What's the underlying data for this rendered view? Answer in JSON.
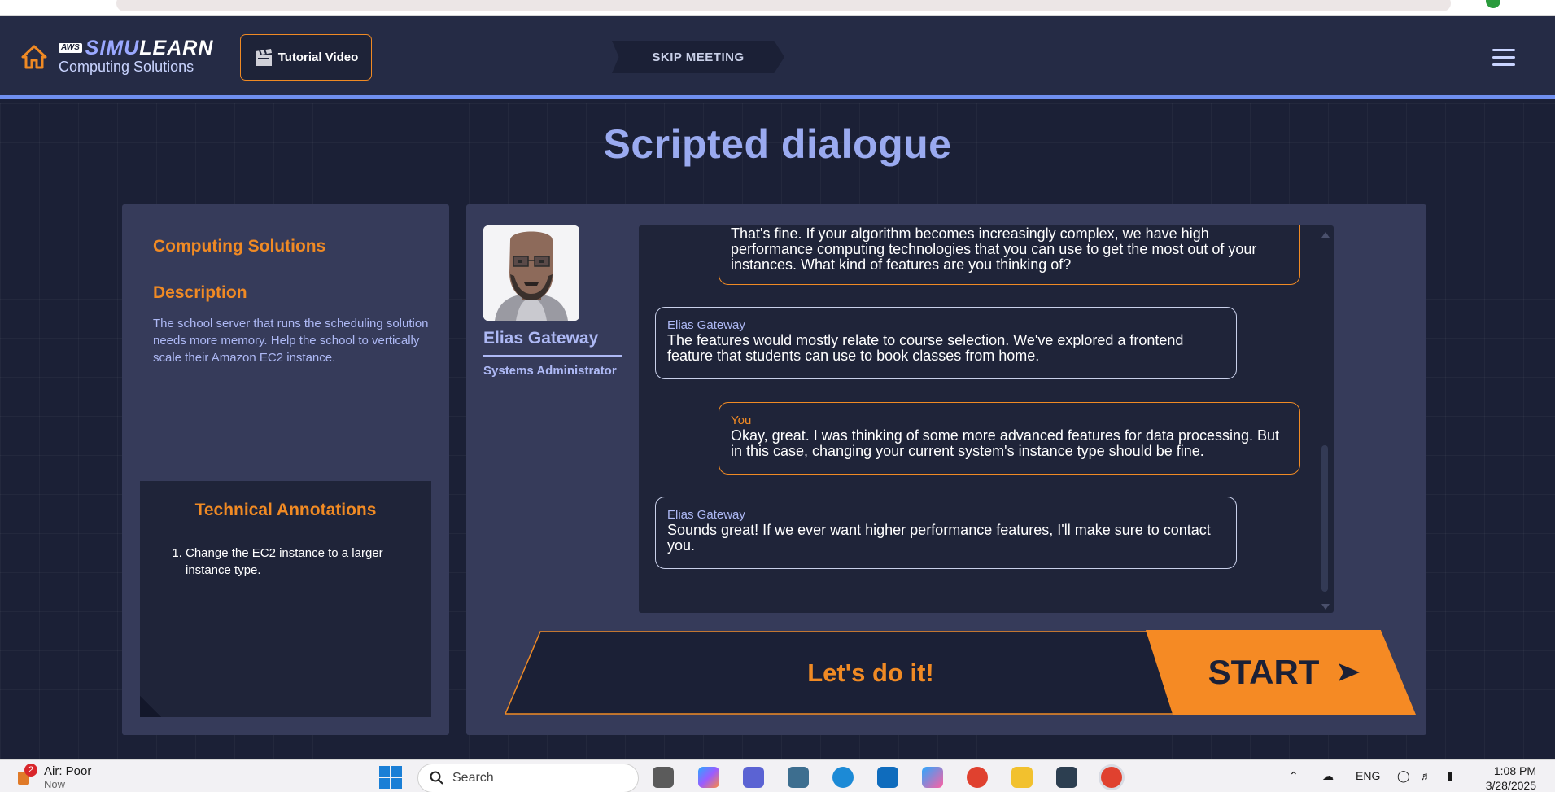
{
  "header": {
    "logo_aws": "AWS",
    "logo_brand_1": "SIMU",
    "logo_brand_2": "LEARN",
    "logo_subtitle": "Computing Solutions",
    "tutorial_label": "Tutorial Video",
    "skip_label": "SKIP MEETING"
  },
  "page": {
    "title": "Scripted dialogue"
  },
  "left_panel": {
    "heading": "Computing Solutions",
    "description_heading": "Description",
    "description": "The school server that runs the scheduling solution needs more memory. Help the school to vertically scale their Amazon EC2 instance.",
    "annotations_title": "Technical Annotations",
    "annotations": [
      "Change the EC2 instance to a larger instance type."
    ]
  },
  "speaker": {
    "name": "Elias Gateway",
    "role": "Systems Administrator"
  },
  "messages": [
    {
      "from": "you",
      "who": "",
      "text": "That's fine. If your algorithm becomes increasingly complex, we have high performance computing technologies that you can use to get the most out of your instances. What kind of features are you thinking of?"
    },
    {
      "from": "npc",
      "who": "Elias Gateway",
      "text": "The features would mostly relate to course selection. We've explored a frontend feature that students can use to book classes from home."
    },
    {
      "from": "you",
      "who": "You",
      "text": "Okay, great. I was thinking of some more advanced features for data processing. But in this case, changing your current system's instance type should be fine."
    },
    {
      "from": "npc",
      "who": "Elias Gateway",
      "text": "Sounds great! If we ever want higher performance features, I'll make sure to contact you."
    }
  ],
  "actions": {
    "lets_do_it": "Let's do it!",
    "start": "START"
  },
  "taskbar": {
    "weather_badge": "2",
    "weather_label": "Air: Poor",
    "weather_sub": "Now",
    "search_placeholder": "Search",
    "lang": "ENG",
    "time": "1:08 PM",
    "date": "3/28/2025"
  },
  "colors": {
    "accent_orange": "#f08a24",
    "accent_blue": "#6f8ff0",
    "panel": "#363b5a",
    "background": "#1b2036"
  }
}
